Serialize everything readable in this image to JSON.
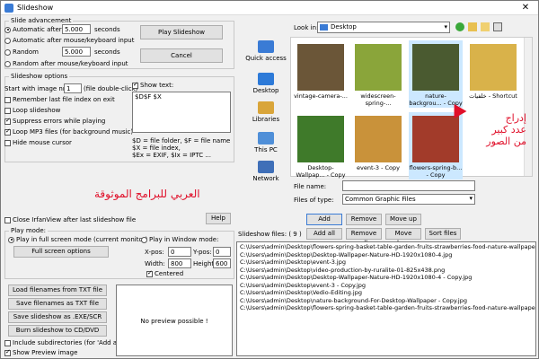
{
  "window": {
    "title": "Slideshow",
    "close_label": "✕"
  },
  "slide_advancement": {
    "label": "Slide advancement",
    "auto_after_label": "Automatic after",
    "auto_after_value": "5.000",
    "seconds_label": "seconds",
    "auto_after_input_label": "Automatic after mouse/keyboard input",
    "random_after_label": "Random",
    "random_after_value": "5.000",
    "random_seconds_label": "seconds",
    "random_after_input_label": "Random after mouse/keyboard input",
    "play_button": "Play Slideshow",
    "cancel_button": "Cancel"
  },
  "slideshow_options": {
    "label": "Slideshow options",
    "start_with_image_label": "Start with image nr.:",
    "start_with_image_value": "1",
    "double_click_hint": "(file double-click)",
    "remember_last_file": "Remember last file index on exit",
    "loop_slideshow": "Loop slideshow",
    "suppress_errors": "Suppress errors while playing",
    "loop_mp3": "Loop MP3 files (for background music)",
    "hide_cursor": "Hide mouse cursor",
    "show_text_label": "Show text:",
    "show_text_value": "$D$F $X",
    "legend_1": "$D = file folder, $F = file name",
    "legend_2": "$X = file index,",
    "legend_3": "$Ex = EXIF, $Ix = IPTC ..."
  },
  "arabic_watermark": "العربي للبرامج الموثوقة",
  "arabic_callout": [
    "إدراج",
    "عدد كبير",
    "من الصور"
  ],
  "close_after_label": "Close IrfanView after last slideshow file",
  "help_button": "Help",
  "play_mode": {
    "label": "Play mode:",
    "full_screen_label": "Play in full screen mode (current monitor)",
    "full_screen_options_button": "Full screen options",
    "window_mode_label": "Play in Window mode:",
    "xpos_label": "X-pos:",
    "xpos_value": "0",
    "ypos_label": "Y-pos:",
    "ypos_value": "0",
    "width_label": "Width:",
    "width_value": "800",
    "height_label": "Height:",
    "height_value": "600",
    "centered_label": "Centered"
  },
  "bottom_buttons": [
    "Load filenames from TXT file",
    "Save filenames as TXT file",
    "Save slideshow as .EXE/SCR",
    "Burn slideshow to CD/DVD"
  ],
  "include_subdirs": "Include subdirectories (for 'Add all')",
  "show_preview": "Show Preview image",
  "no_preview": "No preview possible !",
  "browser": {
    "look_in_label": "Look in:",
    "look_in_value": "Desktop",
    "nav": [
      "Quick access",
      "Desktop",
      "Libraries",
      "This PC",
      "Network"
    ],
    "thumbnails": [
      {
        "caption": "vintage-camera-...",
        "color": "#6b5638"
      },
      {
        "caption": "widescreen-spring-...",
        "color": "#8aa53a"
      },
      {
        "caption": "nature-backgrou... - Copy",
        "color": "#4a5a30"
      },
      {
        "caption": "خلفيات - Shortcut",
        "color": "#d9b24a"
      },
      {
        "caption": "Desktop-Wallpap... - Copy",
        "color": "#3f7a2a"
      },
      {
        "caption": "event-3 - Copy",
        "color": "#c9923a"
      },
      {
        "caption": "flowers-spring-b... - Copy",
        "color": "#a23b2a"
      }
    ],
    "file_name_label": "File name:",
    "file_name_value": "",
    "files_of_type_label": "Files of type:",
    "files_of_type_value": "Common Graphic Files"
  },
  "list_buttons": {
    "add": "Add",
    "remove": "Remove",
    "move_up": "Move up",
    "add_all": "Add all",
    "remove_all": "Remove all",
    "move_down": "Move down",
    "sort_files": "Sort files"
  },
  "slideshow_files": {
    "label": "Slideshow files:",
    "count": "( 9 )",
    "items": [
      "C:\\Users\\admin\\Desktop\\flowers-spring-basket-table-garden-fruits-strawberries-food-nature-wallpaper-for-mobile-hd-",
      "C:\\Users\\admin\\Desktop\\Desktop-Wallpaper-Nature-HD-1920x1080-4.jpg",
      "C:\\Users\\admin\\Desktop\\event-3.jpg",
      "C:\\Users\\admin\\Desktop\\video-production-by-ruralite-01-825x438.png",
      "C:\\Users\\admin\\Desktop\\Desktop-Wallpaper-Nature-HD-1920x1080-4 - Copy.jpg",
      "C:\\Users\\admin\\Desktop\\event-3 - Copy.jpg",
      "C:\\Users\\admin\\Desktop\\Vedio-Editing.jpg",
      "C:\\Users\\admin\\Desktop\\nature-background-For-Desktop-Wallpaper - Copy.jpg",
      "C:\\Users\\admin\\Desktop\\flowers-spring-basket-table-garden-fruits-strawberries-food-nature-wallpaper-for-mobile-hd-"
    ]
  }
}
